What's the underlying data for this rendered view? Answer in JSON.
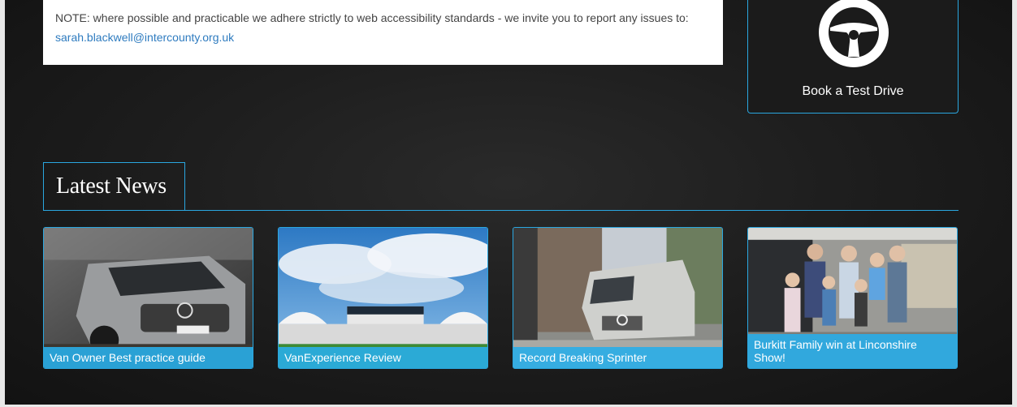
{
  "note": {
    "text": "NOTE: where possible and practicable we adhere strictly to web accessibility standards - we invite you to report any issues to: ",
    "email": "sarah.blackwell@intercounty.org.uk"
  },
  "test_drive": {
    "label": "Book a Test Drive",
    "icon": "steering-wheel-icon"
  },
  "news": {
    "heading": "Latest News",
    "items": [
      {
        "title": "Van Owner Best practice guide"
      },
      {
        "title": "VanExperience Review"
      },
      {
        "title": "Record Breaking Sprinter"
      },
      {
        "title": "Burkitt Family win at Linconshire Show!"
      }
    ]
  },
  "colors": {
    "accent": "#2aa7e0",
    "background": "#1e1e1e",
    "caption": "#29ade8"
  }
}
